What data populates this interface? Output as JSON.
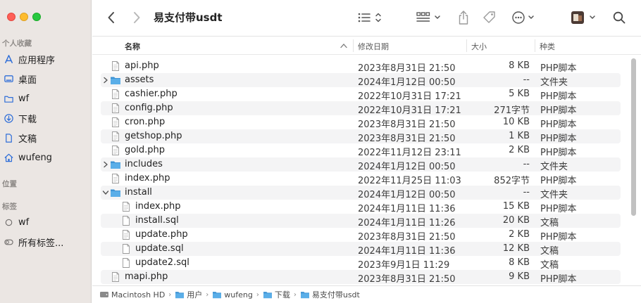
{
  "window": {
    "title": "易支付带usdt"
  },
  "sidebar": {
    "favorites_label": "个人收藏",
    "favorites": [
      {
        "label": "应用程序",
        "icon": "app-store-icon"
      },
      {
        "label": "桌面",
        "icon": "desktop-icon"
      },
      {
        "label": "wf",
        "icon": "folder-icon"
      },
      {
        "label": "下载",
        "icon": "download-icon"
      },
      {
        "label": "文稿",
        "icon": "document-icon"
      },
      {
        "label": "wufeng",
        "icon": "home-icon"
      }
    ],
    "locations_label": "位置",
    "tags_label": "标签",
    "tags": [
      {
        "label": "wf",
        "icon": "tag-circle-icon"
      },
      {
        "label": "所有标签...",
        "icon": "all-tags-icon"
      }
    ],
    "accent_color": "#2f6ed8"
  },
  "columns": {
    "name": "名称",
    "date": "修改日期",
    "size": "大小",
    "kind": "种类"
  },
  "files": [
    {
      "name": "api.php",
      "date": "2023年8月31日 21:50",
      "size": "8 KB",
      "kind": "PHP脚本",
      "type": "file",
      "level": 0
    },
    {
      "name": "assets",
      "date": "2024年1月12日 00:50",
      "size": "--",
      "kind": "文件夹",
      "type": "folder",
      "level": 0,
      "expanded": false
    },
    {
      "name": "cashier.php",
      "date": "2022年10月31日 17:21",
      "size": "5 KB",
      "kind": "PHP脚本",
      "type": "file",
      "level": 0
    },
    {
      "name": "config.php",
      "date": "2022年10月31日 17:21",
      "size": "271字节",
      "kind": "PHP脚本",
      "type": "file",
      "level": 0
    },
    {
      "name": "cron.php",
      "date": "2023年8月31日 21:50",
      "size": "10 KB",
      "kind": "PHP脚本",
      "type": "file",
      "level": 0
    },
    {
      "name": "getshop.php",
      "date": "2023年8月31日 21:50",
      "size": "1 KB",
      "kind": "PHP脚本",
      "type": "file",
      "level": 0
    },
    {
      "name": "gold.php",
      "date": "2022年11月12日 23:11",
      "size": "2 KB",
      "kind": "PHP脚本",
      "type": "file",
      "level": 0
    },
    {
      "name": "includes",
      "date": "2024年1月12日 00:50",
      "size": "--",
      "kind": "文件夹",
      "type": "folder",
      "level": 0,
      "expanded": false
    },
    {
      "name": "index.php",
      "date": "2022年11月25日 11:03",
      "size": "852字节",
      "kind": "PHP脚本",
      "type": "file",
      "level": 0
    },
    {
      "name": "install",
      "date": "2024年1月12日 00:50",
      "size": "--",
      "kind": "文件夹",
      "type": "folder",
      "level": 0,
      "expanded": true
    },
    {
      "name": "index.php",
      "date": "2024年1月11日 11:36",
      "size": "15 KB",
      "kind": "PHP脚本",
      "type": "file",
      "level": 1
    },
    {
      "name": "install.sql",
      "date": "2024年1月11日 11:26",
      "size": "20 KB",
      "kind": "文稿",
      "type": "file",
      "level": 1
    },
    {
      "name": "update.php",
      "date": "2023年8月31日 21:50",
      "size": "2 KB",
      "kind": "PHP脚本",
      "type": "file",
      "level": 1
    },
    {
      "name": "update.sql",
      "date": "2024年1月11日 11:36",
      "size": "12 KB",
      "kind": "文稿",
      "type": "file",
      "level": 1
    },
    {
      "name": "update2.sql",
      "date": "2023年9月1日 11:29",
      "size": "8 KB",
      "kind": "文稿",
      "type": "file",
      "level": 1
    },
    {
      "name": "mapi.php",
      "date": "2023年8月31日 21:50",
      "size": "9 KB",
      "kind": "PHP脚本",
      "type": "file",
      "level": 0
    }
  ],
  "pathbar": [
    {
      "label": "Macintosh HD",
      "icon": "hard-drive-icon"
    },
    {
      "label": "用户",
      "icon": "folder-icon"
    },
    {
      "label": "wufeng",
      "icon": "folder-icon"
    },
    {
      "label": "下载",
      "icon": "folder-icon"
    },
    {
      "label": "易支付带usdt",
      "icon": "folder-icon"
    }
  ],
  "colors": {
    "folder": "#5aaee8",
    "folder_dark": "#3e93d4"
  }
}
